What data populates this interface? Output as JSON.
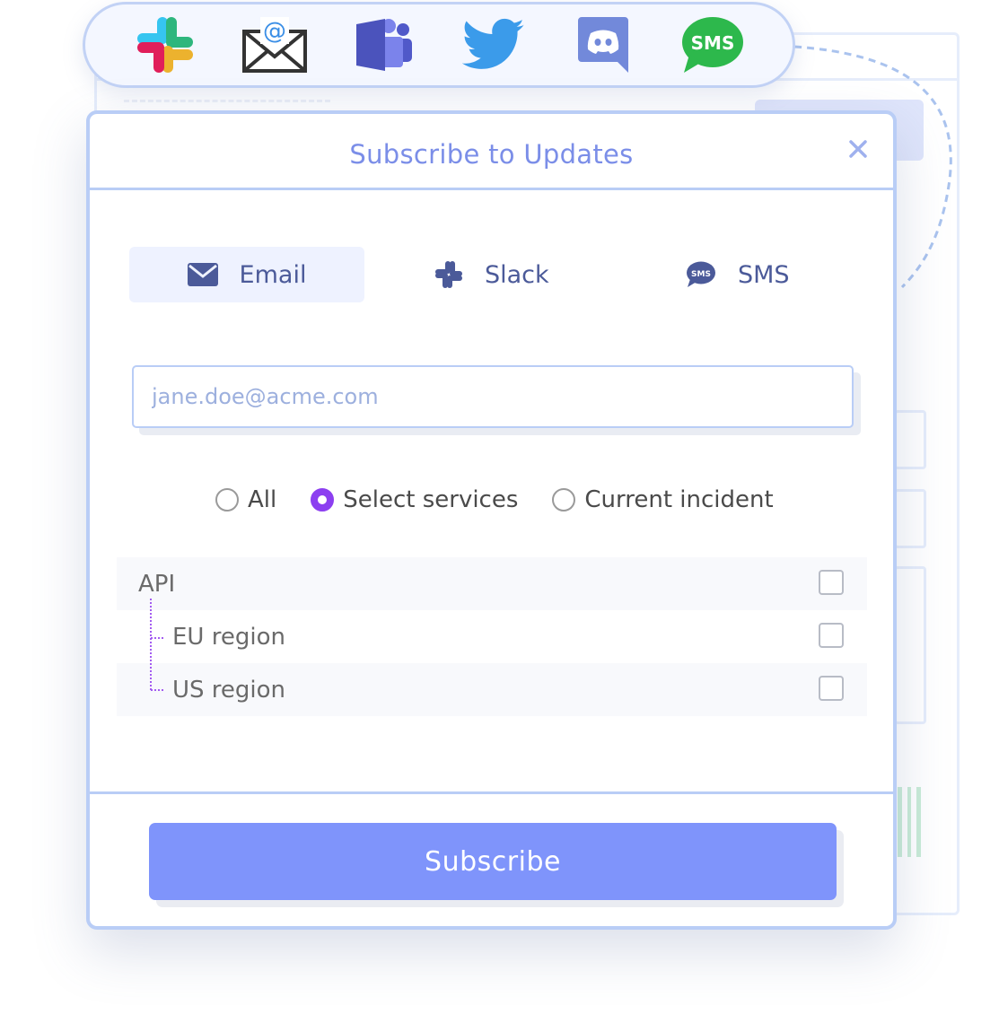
{
  "channels": [
    {
      "icon": "slack-logo-icon"
    },
    {
      "icon": "email-at-icon"
    },
    {
      "icon": "teams-logo-icon"
    },
    {
      "icon": "twitter-logo-icon"
    },
    {
      "icon": "discord-logo-icon"
    },
    {
      "icon": "sms-bubble-icon",
      "text": "SMS"
    }
  ],
  "modal": {
    "title": "Subscribe to Updates",
    "close_icon": "close-icon"
  },
  "tabs": [
    {
      "label": "Email",
      "icon": "envelope-icon",
      "active": true
    },
    {
      "label": "Slack",
      "icon": "slack-icon",
      "active": false
    },
    {
      "label": "SMS",
      "icon": "sms-bubble-icon",
      "active": false
    }
  ],
  "email": {
    "value": "",
    "placeholder": "jane.doe@acme.com"
  },
  "scope": {
    "options": [
      "All",
      "Select services",
      "Current incident"
    ],
    "selected": "Select services"
  },
  "services": [
    {
      "label": "API",
      "checked": false,
      "level": 0
    },
    {
      "label": "EU region",
      "checked": false,
      "level": 1
    },
    {
      "label": "US region",
      "checked": false,
      "level": 1
    }
  ],
  "submit": {
    "label": "Subscribe"
  },
  "colors": {
    "accent": "#7f94fb",
    "title": "#7b8ee8",
    "border": "#b9cdf6",
    "radio_checked": "#8c3ff0",
    "tab_active_bg": "#eef2ff"
  }
}
